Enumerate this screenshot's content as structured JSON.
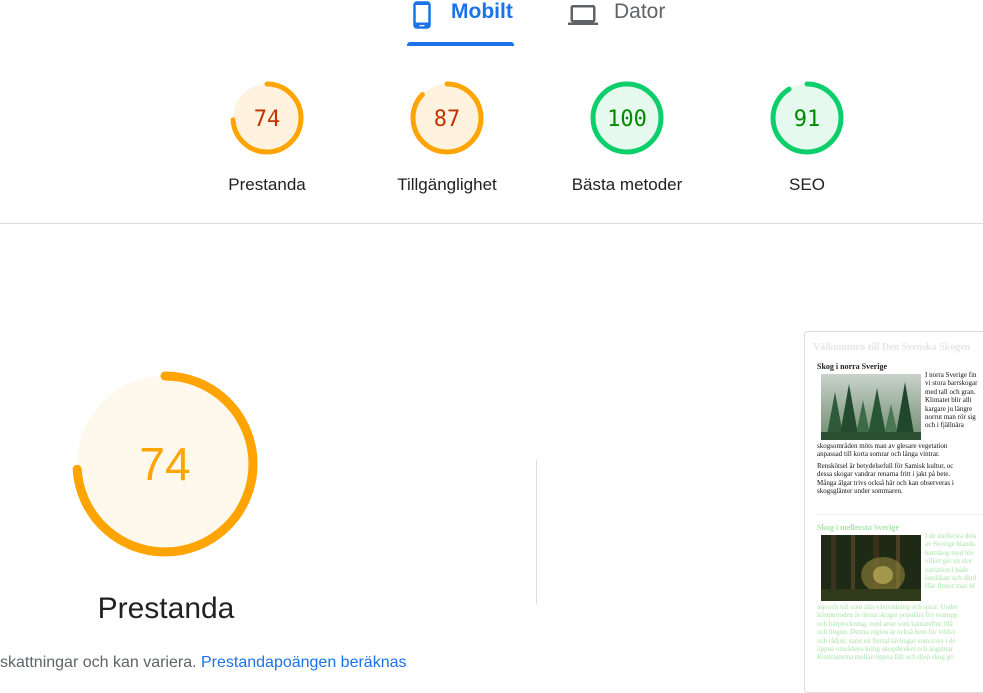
{
  "tabs": {
    "mobile": {
      "label": "Mobilt",
      "icon": "phone-icon",
      "active": true
    },
    "desktop": {
      "label": "Dator",
      "icon": "laptop-icon",
      "active": false
    }
  },
  "scores": [
    {
      "label": "Prestanda",
      "value": "74",
      "percent": 74,
      "status": "average",
      "color": "#ffa400",
      "text_color": "#c33300",
      "fill": "#fff3e0"
    },
    {
      "label": "Tillgänglighet",
      "value": "87",
      "percent": 87,
      "status": "average",
      "color": "#ffa400",
      "text_color": "#c33300",
      "fill": "#fff3e0"
    },
    {
      "label": "Bästa metoder",
      "value": "100",
      "percent": 100,
      "status": "pass",
      "color": "#0cce6b",
      "text_color": "#008800",
      "fill": "#e6f9ee"
    },
    {
      "label": "SEO",
      "value": "91",
      "percent": 91,
      "status": "pass",
      "color": "#0cce6b",
      "text_color": "#008800",
      "fill": "#e6f9ee"
    }
  ],
  "main": {
    "score": "74",
    "percent": 74,
    "title": "Prestanda",
    "color": "#ffa400",
    "fill": "#fff8ec",
    "note_text": "skattningar och kan variera.",
    "note_link": "Prestandapoängen beräknas"
  },
  "screenshot": {
    "header": "Välkommen till Den Svenska Skogen",
    "sections": [
      {
        "heading": "Skog i norra Sverige",
        "lines_right": [
          "I norra Sverige fin",
          "vi stora barrskogar",
          "med tall och gran.",
          "Klimatet blir allt",
          "kargare ju längre",
          "norrut man rör sig",
          "och i fjällnära"
        ],
        "lines_below": [
          "skogsområden möts man av glesare vegetation",
          "anpassad till korta somrar och långa vintrar."
        ],
        "paragraph2": [
          "Renskötsel är betydelsefull för Samisk kultur, oc",
          "dessa skogar vandrar renarna fritt i jakt på bete.",
          "Många älgar trivs också här och kan observeras i",
          "skogsglänter under sommaren."
        ]
      },
      {
        "heading": "Skog i mellersta Sverige",
        "lines_right": [
          "I de mellersta dela",
          "av Sverige blanda",
          "barrskog med löv",
          "vilket ger en stor",
          "variation i både",
          "landskap och djurl",
          "Här finner man bl"
        ],
        "lines_below": [
          "asp och tall som alla växtordning och sprar. Under",
          "höstperioden är dessa skogar populära för svampp",
          "och bärplockning, med arter som kantareller, blå",
          "och lingon. Denna region är också hem för vildsv",
          "och rådjur, samt ett flertal tävlingar som trivs i de",
          "öppna områdena kring skogsbruket och ängsmar",
          "Kontrasterna mellan öppna fält och djup skog gö"
        ]
      }
    ]
  }
}
